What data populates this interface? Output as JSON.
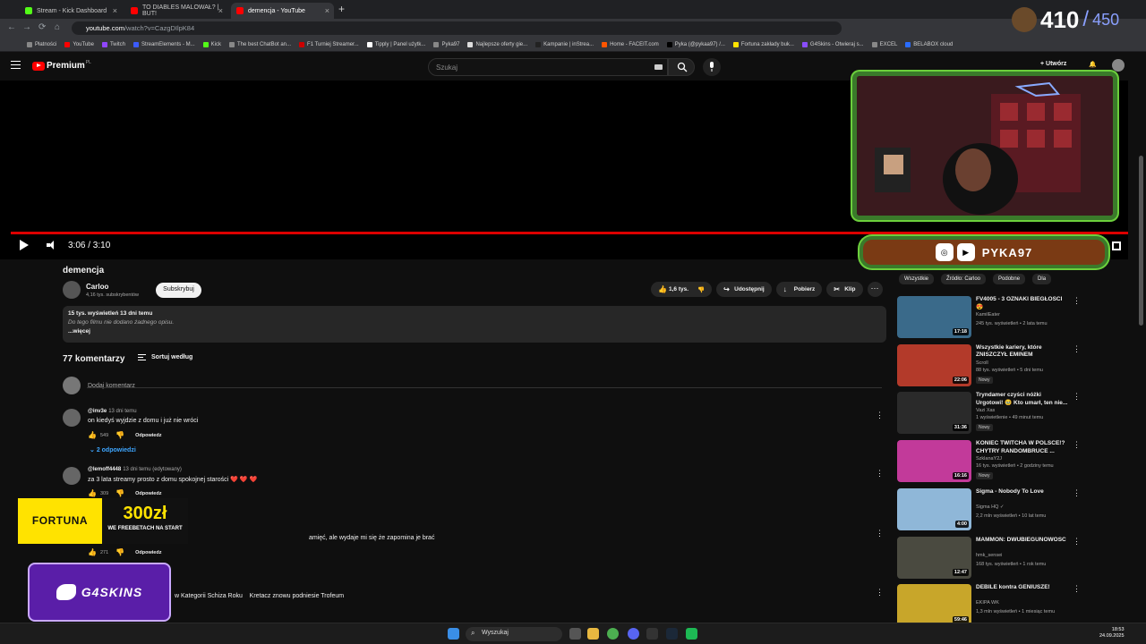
{
  "browser": {
    "tabs": [
      {
        "title": "Stream - Kick Dashboard",
        "color": "#53fc18"
      },
      {
        "title": "TO DIABLES MALOWAŁ? | BUT!",
        "color": "#ff0000"
      },
      {
        "title": "demencja - YouTube",
        "color": "#ff0000"
      }
    ],
    "address": {
      "host": "youtube.com",
      "path": "/watch?v=CazgDIlpK84"
    },
    "bookmarks": [
      "Płatności",
      "YouTube",
      "Twitch",
      "StreamElements - M...",
      "Kick",
      "The best ChatBot an...",
      "F1 Turniej Streamer...",
      "Tipply | Panel użytk...",
      "Pyka97",
      "Najlepsze oferty gie...",
      "Kampanie | inStrea...",
      "Home - FACEIT.com",
      "Pyka (@pykaa97) /...",
      "Fortuna zakłady buk...",
      "G4Skins - Otwieraj s...",
      "EXCEL",
      "BELABOX cloud"
    ]
  },
  "youtube": {
    "logo_text": "Premium",
    "logo_region": "PL",
    "search_placeholder": "Szukaj",
    "create_label": "Utwórz",
    "player": {
      "time": "3:06 / 3:10",
      "progress": 0.98
    },
    "video_title": "demencja",
    "channel": {
      "name": "Carloo",
      "subs": "4,16 tys. subskrybentów"
    },
    "subscribe_label": "Subskrybuj",
    "actions": {
      "likes": "1,6 tys.",
      "share": "Udostępnij",
      "download": "Pobierz",
      "clip": "Klip"
    },
    "description": {
      "meta": "15 tys. wyświetleń  13 dni temu",
      "text": "Do tego filmu nie dodano żadnego opisu.",
      "more": "...więcej"
    },
    "comments_count": "77 komentarzy",
    "sort_label": "Sortuj według",
    "add_comment": "Dodaj komentarz",
    "comments": [
      {
        "author": "@inv3e",
        "time": "13 dni temu",
        "text": "on kiedyś wyjdzie z domu i już nie wróci",
        "likes": "549",
        "reply": "Odpowiedz"
      },
      {
        "author": "@lemoff4448",
        "time": "13 dni temu (edytowany)",
        "text": "za 3 lata streamy prosto z domu spokojnej starości ❤️ ❤️ ❤️",
        "likes": "309",
        "reply": "Odpowiedz"
      },
      {
        "author": "",
        "time": "",
        "text": "amięć, ale wydaje mi się że zapomina je brać",
        "likes": "271",
        "reply": "Odpowiedz"
      },
      {
        "author": "",
        "time": "",
        "text": "w Kategorii Schiza Roku    Kretacz znowu podniesie Trofeum",
        "likes": "",
        "reply": ""
      }
    ],
    "replies_label": "2 odpowiedzi",
    "chips": [
      "Wszystkie",
      "Źródło: Carloo",
      "Podobne",
      "Dla"
    ],
    "recommendations": [
      {
        "title": "FV4005 - 3 OZNAKI BIEGŁOŚCI 😍",
        "channel": "KamilEater",
        "stats": "245 tys. wyświetleń • 2 lata temu",
        "duration": "17:18",
        "badge": "",
        "thumb": "#3a6a8a"
      },
      {
        "title": "Wszystkie kariery, które ZNISZCZYŁ EMINEM",
        "channel": "Scroll",
        "stats": "88 tys. wyświetleń • 5 dni temu",
        "duration": "22:06",
        "badge": "Nowy",
        "thumb": "#b33a2a"
      },
      {
        "title": "Tryndamer czyści nóżki Urgotowi! 🥹 Kto umarł, ten nie...",
        "channel": "Vazi Xas",
        "stats": "1 wyświetlenie • 49 minut temu",
        "duration": "31:36",
        "badge": "Nowy",
        "thumb": "#2a2a2a"
      },
      {
        "title": "KONIEC TWITCHA W POLSCE!? CHYTRY RANDOMBRUCE ...",
        "channel": "SzklanaY2J",
        "stats": "16 tys. wyświetleń • 2 godziny temu",
        "duration": "16:16",
        "badge": "Nowy",
        "thumb": "#c23a9a"
      },
      {
        "title": "Sigma - Nobody To Love",
        "channel": "Sigma HQ ✓",
        "stats": "2,2 mln wyświetleń • 10 lat temu",
        "duration": "4:00",
        "badge": "",
        "thumb": "#8fb7d8"
      },
      {
        "title": "MAMMON: DWUBIEGUNOWOŚĆ",
        "channel": "hmk_sensei",
        "stats": "168 tys. wyświetleń • 1 rok temu",
        "duration": "12:47",
        "badge": "",
        "thumb": "#4a4a40"
      },
      {
        "title": "DEBILE kontra GENIUSZE!",
        "channel": "EKIPA WK",
        "stats": "1,3 mln wyświetleń • 1 miesiąc temu",
        "duration": "59:46",
        "badge": "",
        "thumb": "#c8a62a"
      }
    ]
  },
  "overlays": {
    "counter": {
      "current": "410",
      "max": "450"
    },
    "streamer_name": "PYKA97",
    "fortuna": {
      "brand": "FORTUNA",
      "amount": "300zł",
      "tagline": "WE FREEBETACH NA START"
    },
    "g4skins": "G4SKINS"
  },
  "taskbar": {
    "search": "Wyszukaj",
    "time": "18:53",
    "date": "24.09.2025"
  }
}
